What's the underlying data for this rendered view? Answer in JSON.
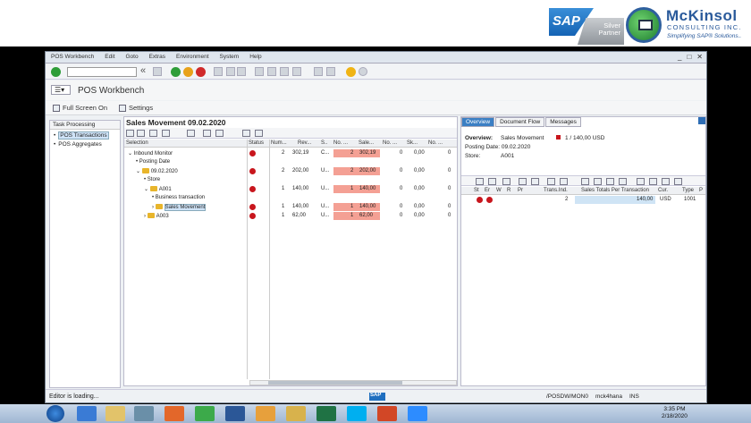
{
  "banner": {
    "sap_logo": "SAP",
    "badge_line1": "Silver",
    "badge_line2": "Partner",
    "company": "McKinsol",
    "company_sub": "CONSULTING INC.",
    "tagline": "Simplifying SAP® Solutions.."
  },
  "menu": [
    "POS Workbench",
    "Edit",
    "Goto",
    "Extras",
    "Environment",
    "System",
    "Help"
  ],
  "page_title": "POS Workbench",
  "app_toolbar": {
    "fullscreen": "Full Screen On",
    "settings": "Settings"
  },
  "left_pane": {
    "header": "Task Processing",
    "items": [
      {
        "label": "POS Transactions",
        "selected": true
      },
      {
        "label": "POS Aggregates",
        "selected": false
      }
    ]
  },
  "mid_pane": {
    "title": "Sales Movement 09.02.2020",
    "columns": [
      "Selection",
      "Status",
      "Num...",
      "Rev...",
      "S..",
      "No. ...",
      "Sale...",
      "No. ...",
      "Sk...",
      "No. ..."
    ],
    "rows": [
      {
        "selection": "Inbound Monitor",
        "indent": 0,
        "icon": "arrow",
        "status": true,
        "num": "2",
        "rev": "302,19",
        "s": "C...",
        "no1": "2",
        "sale": "302,19",
        "no2": "0",
        "sk": "0,00",
        "no3": "0",
        "highlight": true
      },
      {
        "selection": "Posting Date",
        "indent": 1,
        "icon": "bullet",
        "status": false,
        "num": "",
        "rev": "",
        "s": "",
        "no1": "",
        "sale": "",
        "no2": "",
        "sk": "",
        "no3": "",
        "highlight": false
      },
      {
        "selection": "09.02.2020",
        "indent": 1,
        "icon": "folder-open",
        "status": true,
        "num": "2",
        "rev": "202,00",
        "s": "U...",
        "no1": "2",
        "sale": "202,00",
        "no2": "0",
        "sk": "0,00",
        "no3": "0",
        "highlight": true
      },
      {
        "selection": "Store",
        "indent": 2,
        "icon": "bullet",
        "status": false,
        "num": "",
        "rev": "",
        "s": "",
        "no1": "",
        "sale": "",
        "no2": "",
        "sk": "",
        "no3": "",
        "highlight": false
      },
      {
        "selection": "A001",
        "indent": 2,
        "icon": "folder-open",
        "status": true,
        "num": "1",
        "rev": "140,00",
        "s": "U...",
        "no1": "1",
        "sale": "140,00",
        "no2": "0",
        "sk": "0,00",
        "no3": "0",
        "highlight": true
      },
      {
        "selection": "Business transaction",
        "indent": 3,
        "icon": "bullet",
        "status": false,
        "num": "",
        "rev": "",
        "s": "",
        "no1": "",
        "sale": "",
        "no2": "",
        "sk": "",
        "no3": "",
        "highlight": false
      },
      {
        "selection": "Sales Movement",
        "indent": 3,
        "icon": "folder",
        "status": true,
        "num": "1",
        "rev": "140,00",
        "s": "U...",
        "no1": "1",
        "sale": "140,00",
        "no2": "0",
        "sk": "0,00",
        "no3": "0",
        "highlight": true,
        "selected": true
      },
      {
        "selection": "A003",
        "indent": 2,
        "icon": "folder",
        "status": true,
        "num": "1",
        "rev": "62,00",
        "s": "U...",
        "no1": "1",
        "sale": "62,00",
        "no2": "0",
        "sk": "0,00",
        "no3": "0",
        "highlight": true
      }
    ]
  },
  "right_pane": {
    "tabs": [
      "Overview",
      "Document Flow",
      "Messages"
    ],
    "overview_label": "Overview:",
    "overview_value": "Sales Movement",
    "overview_count": "1 / 140,00 USD",
    "posting_label": "Posting Date: 09.02.2020",
    "store_label": "Store:",
    "store_value": "A001",
    "columns": [
      "St",
      "Er",
      "W",
      "R",
      "Pr",
      "Trans.Ind.",
      "Sales Totals Per Transaction",
      "Cur.",
      "Type",
      "P"
    ],
    "row": {
      "trans_ind": "2",
      "sales_total": "140,00",
      "cur": "USD",
      "type": "1001"
    }
  },
  "status_bar": {
    "message": "Editor is loading...",
    "sap": "SAP",
    "session": "/POSDW/MON0",
    "server": "mck4hana",
    "mode": "INS"
  },
  "taskbar": {
    "time": "3:35 PM",
    "date": "2/18/2020"
  }
}
